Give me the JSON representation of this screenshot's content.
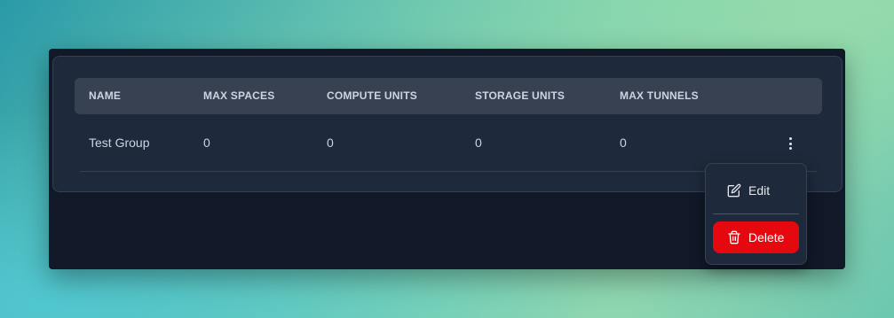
{
  "table": {
    "headers": [
      "NAME",
      "MAX SPACES",
      "COMPUTE UNITS",
      "STORAGE UNITS",
      "MAX TUNNELS"
    ],
    "rows": [
      {
        "name": "Test Group",
        "max_spaces": "0",
        "compute_units": "0",
        "storage_units": "0",
        "max_tunnels": "0"
      }
    ]
  },
  "menu": {
    "edit_label": "Edit",
    "edit_icon": "pencil-square-icon",
    "delete_label": "Delete",
    "delete_icon": "trash-icon",
    "delete_color": "#e5090f"
  },
  "colors": {
    "window_bg": "#111827",
    "card_bg": "#1e293b",
    "header_bg": "#374151"
  }
}
